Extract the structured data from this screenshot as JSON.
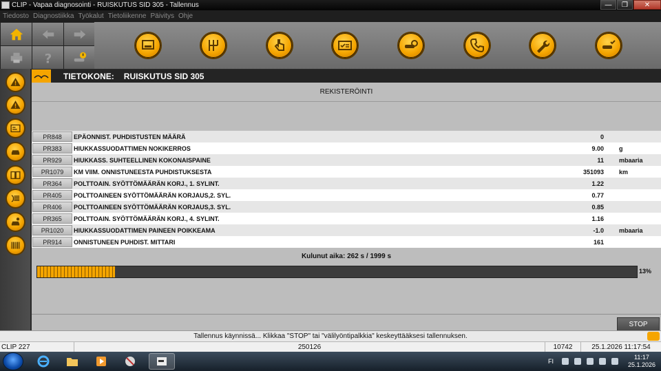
{
  "window": {
    "title": "CLIP - Vapaa diagnosointi - RUISKUTUS SID 305 - Tallennus"
  },
  "menu": [
    "Tiedosto",
    "Diagnostiikka",
    "Työkalut",
    "Tietoliikenne",
    "Päivitys",
    "Ohje"
  ],
  "header": {
    "label": "TIETOKONE:",
    "value": "RUISKUTUS SID 305"
  },
  "section_title": "REKISTERÖINTI",
  "rows": [
    {
      "code": "PR848",
      "desc": "EPÄONNIST. PUHDISTUSTEN MÄÄRÄ",
      "value": "0",
      "unit": ""
    },
    {
      "code": "PR383",
      "desc": "HIUKKASSUODATTIMEN NOKIKERROS",
      "value": "9.00",
      "unit": "g"
    },
    {
      "code": "PR929",
      "desc": "HIUKKASS. SUHTEELLINEN KOKONAISPAINE",
      "value": "11",
      "unit": "mbaaria"
    },
    {
      "code": "PR1079",
      "desc": "KM VIIM. ONNISTUNEESTA PUHDISTUKSESTA",
      "value": "351093",
      "unit": "km"
    },
    {
      "code": "PR364",
      "desc": "POLTTOAIN. SYÖTTÖMÄÄRÄN KORJ., 1. SYLINT.",
      "value": "1.22",
      "unit": ""
    },
    {
      "code": "PR405",
      "desc": "POLTTOAINEEN SYÖTTÖMÄÄRÄN KORJAUS,2. SYL.",
      "value": "0.77",
      "unit": ""
    },
    {
      "code": "PR406",
      "desc": "POLTTOAINEEN SYÖTTÖMÄÄRÄN KORJAUS,3. SYL.",
      "value": "0.85",
      "unit": ""
    },
    {
      "code": "PR365",
      "desc": "POLTTOAIN. SYÖTTÖMÄÄRÄN KORJ., 4. SYLINT.",
      "value": "1.16",
      "unit": ""
    },
    {
      "code": "PR1020",
      "desc": "HIUKKASSUODATTIMEN PAINEEN POIKKEAMA",
      "value": "-1.0",
      "unit": "mbaaria"
    },
    {
      "code": "PR914",
      "desc": "ONNISTUNEEN PUHDIST. MITTARI",
      "value": "161",
      "unit": ""
    }
  ],
  "elapsed": {
    "label": "Kulunut aika:",
    "value": "262 s / 1999 s"
  },
  "progress": {
    "fraction": 0.13,
    "label": "13%"
  },
  "stop_label": "STOP",
  "message": "Tallennus käynnissä... Klikkaa \"STOP\" tai \"välilyöntipalkkia\" keskeyttääksesi tallennuksen.",
  "status": {
    "clip": "CLIP 227",
    "counter": "250126",
    "number": "10742",
    "datetime": "25.1.2026 11:17:54"
  },
  "taskbar": {
    "lang": "FI",
    "time": "11:17",
    "date": "25.1.2026"
  },
  "colors": {
    "accent": "#f5a500",
    "background": "#bdbdbd"
  }
}
